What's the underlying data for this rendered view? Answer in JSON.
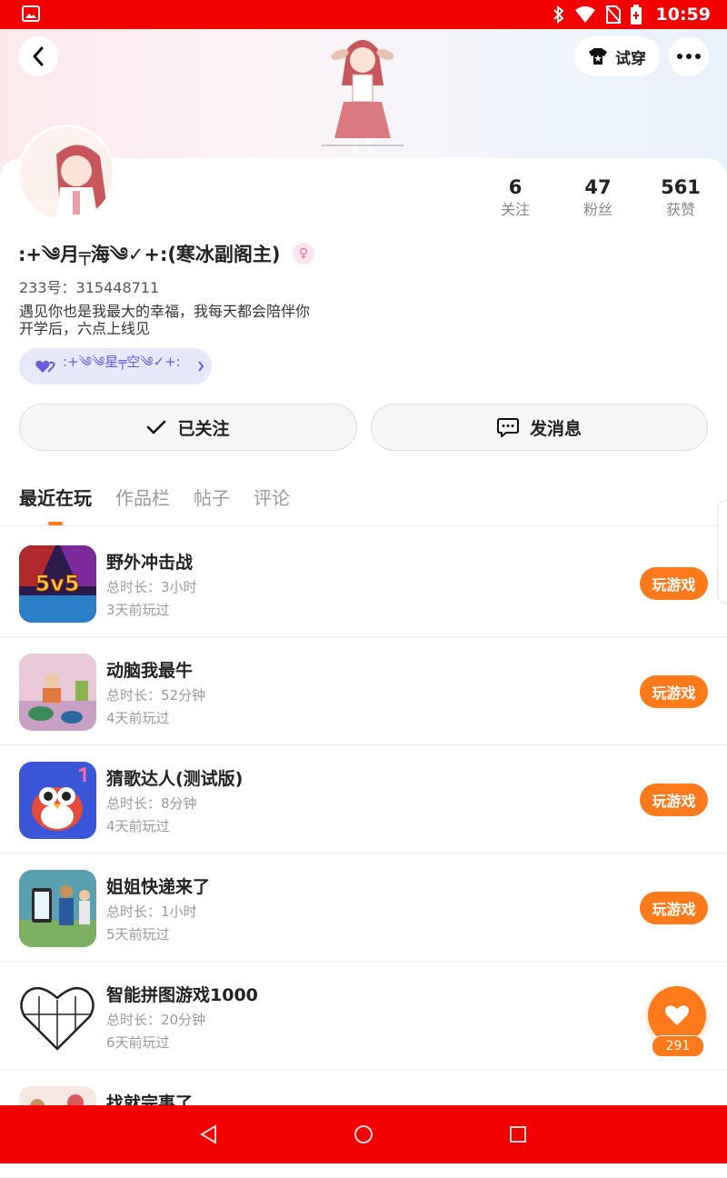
{
  "status_bar": {
    "time": "10:59",
    "colors": {
      "background": "#f20000"
    }
  },
  "header": {
    "tryon_label": "试穿"
  },
  "profile": {
    "nickname": ":+༄月╤海༄✓+:(寒冰副阁主)",
    "uid": "233号：315448711",
    "bio_line1": "遇见你也是我最大的幸福，我每天都会陪伴你",
    "bio_line2": "开学后，六点上线见",
    "guild": ":+༄༄星╤空༄✓+:",
    "stats": [
      {
        "value": "6",
        "label": "关注"
      },
      {
        "value": "47",
        "label": "粉丝"
      },
      {
        "value": "561",
        "label": "获赞"
      }
    ]
  },
  "actions": {
    "follow_label": "已关注",
    "message_label": "发消息"
  },
  "tabs": [
    {
      "label": "最近在玩",
      "active": true
    },
    {
      "label": "作品栏",
      "active": false
    },
    {
      "label": "帖子",
      "active": false
    },
    {
      "label": "评论",
      "active": false
    }
  ],
  "games": [
    {
      "title": "野外冲击战",
      "duration": "总时长：3小时",
      "last": "3天前玩过",
      "play": "玩游戏",
      "icon": "5v5-battle-icon"
    },
    {
      "title": "动脑我最牛",
      "duration": "总时长：52分钟",
      "last": "4天前玩过",
      "play": "玩游戏",
      "icon": "brain-puzzle-icon"
    },
    {
      "title": "猜歌达人(测试版)",
      "duration": "总时长：8分钟",
      "last": "4天前玩过",
      "play": "玩游戏",
      "icon": "owl-music-icon"
    },
    {
      "title": "姐姐快递来了",
      "duration": "总时长：1小时",
      "last": "5天前玩过",
      "play": "玩游戏",
      "icon": "delivery-story-icon"
    },
    {
      "title": "智能拼图游戏1000",
      "duration": "总时长：20分钟",
      "last": "6天前玩过",
      "play": "",
      "icon": "heart-jigsaw-icon"
    },
    {
      "title": "找就完事了",
      "duration": "",
      "last": "",
      "play": "",
      "icon": "find-game-icon"
    }
  ],
  "like": {
    "count": "291"
  },
  "colors": {
    "accent": "#ff7a1a",
    "system_bars": "#f20000"
  }
}
